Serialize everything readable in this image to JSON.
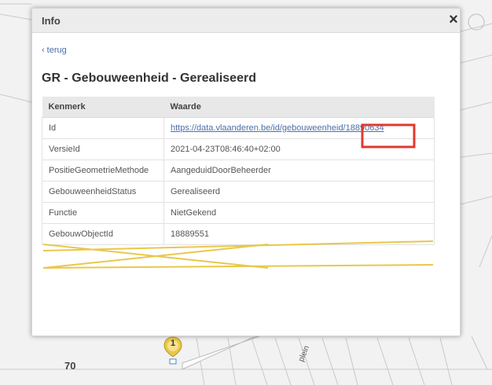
{
  "map": {
    "house_number": "70",
    "street_name": "plein"
  },
  "marker": {
    "number": "1"
  },
  "popup": {
    "title": "Info",
    "close_label": "×",
    "back_label": "terug",
    "feature_title": "GR - Gebouweenheid - Gerealiseerd"
  },
  "table": {
    "headers": [
      "Kenmerk",
      "Waarde"
    ],
    "rows": [
      {
        "key": "Id",
        "value": "https://data.vlaanderen.be/id/gebouweenheid/18890634"
      },
      {
        "key": "VersieId",
        "value": "2021-04-23T08:46:40+02:00"
      },
      {
        "key": "PositieGeometrieMethode",
        "value": "AangeduidDoorBeheerder"
      },
      {
        "key": "GebouweenheidStatus",
        "value": "Gerealiseerd"
      },
      {
        "key": "Functie",
        "value": "NietGekend"
      },
      {
        "key": "GebouwObjectId",
        "value": "18889551"
      }
    ]
  },
  "colors": {
    "highlight_box": "#e03a2f",
    "strike_lines": "#e8c84a",
    "link": "#4a6fa8",
    "marker": "#e8c84a"
  }
}
